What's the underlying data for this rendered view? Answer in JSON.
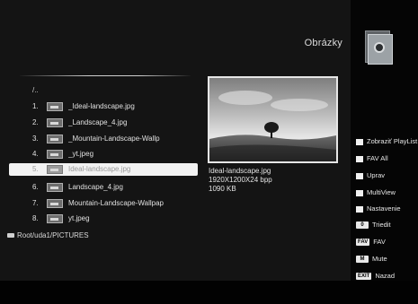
{
  "header": {
    "title": "Obrázky"
  },
  "icons": {
    "folder": "media-folder-icon",
    "usb": "usb-icon"
  },
  "file_list": {
    "parent": "/..",
    "items": [
      {
        "num": "1.",
        "name": "_Ideal-landscape.jpg"
      },
      {
        "num": "2.",
        "name": "_Landscape_4.jpg"
      },
      {
        "num": "3.",
        "name": "_Mountain-Landscape-Wallp"
      },
      {
        "num": "4.",
        "name": "_yt.jpeg"
      },
      {
        "num": "5.",
        "name": "Ideal-landscape.jpg"
      },
      {
        "num": "6.",
        "name": "Landscape_4.jpg"
      },
      {
        "num": "7.",
        "name": "Mountain-Landscape-Wallpap"
      },
      {
        "num": "8.",
        "name": "yt.jpeg"
      }
    ],
    "selected_index": 4
  },
  "path": "Root/uda1/PICTURES",
  "preview": {
    "filename": "Ideal-landscape.jpg",
    "resolution": "1920X1200X24 bpp",
    "size": "1090 KB"
  },
  "menu": [
    {
      "key": "",
      "label": "Zobraziť PlayList",
      "name": "menu-show-playlist"
    },
    {
      "key": "",
      "label": "FAV All",
      "name": "menu-fav-all"
    },
    {
      "key": "",
      "label": "Uprav",
      "name": "menu-edit"
    },
    {
      "key": "",
      "label": "MultiView",
      "name": "menu-multiview"
    },
    {
      "key": "",
      "label": "Nastavenie",
      "name": "menu-settings"
    },
    {
      "key": "0",
      "label": "Triedit",
      "name": "menu-sort"
    },
    {
      "key": "FAV",
      "label": "FAV",
      "name": "menu-fav"
    },
    {
      "key": "M",
      "label": "Mute",
      "name": "menu-mute"
    },
    {
      "key": "EXIT",
      "label": "Nazad",
      "name": "menu-back"
    }
  ]
}
